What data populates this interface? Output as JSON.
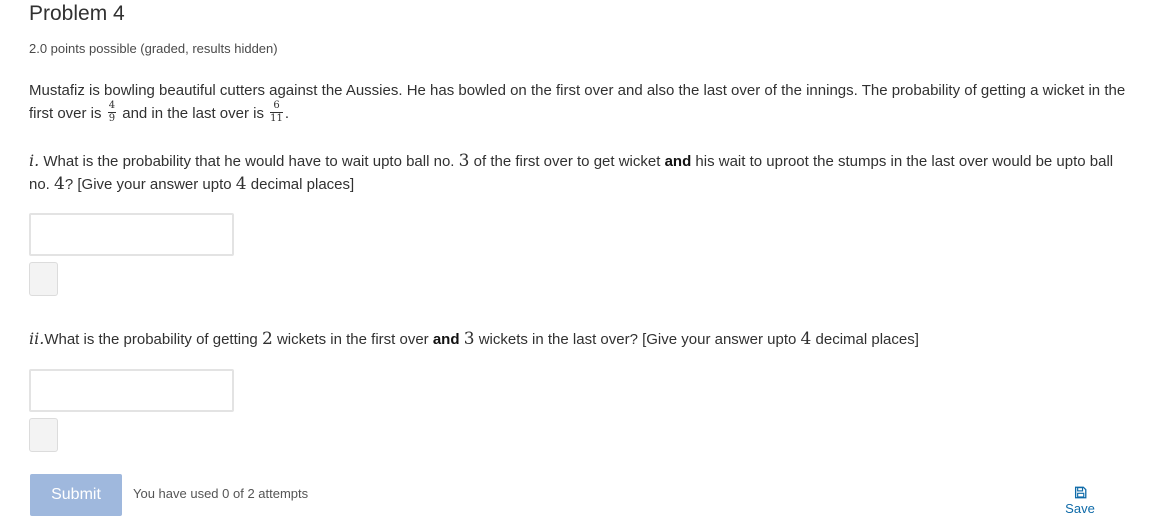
{
  "problem": {
    "title": "Problem 4",
    "points": "2.0 points possible (graded, results hidden)",
    "intro": {
      "text1": "Mustafiz is bowling beautiful cutters against the Aussies. He has bowled on the first over and also the last over of the innings. The probability of getting a wicket in the first over is",
      "frac1_num": "4",
      "frac1_den": "9",
      "text2": "and in the last over is",
      "frac2_num": "6",
      "frac2_den": "11",
      "text3": "."
    },
    "question1": {
      "label": "i.",
      "text1": "What is the probability that he would have to wait upto ball no.",
      "n1": "3",
      "text2": "of the first over to get wicket",
      "bold": "and",
      "text3": "his wait to uproot the stumps in the last over would be upto ball no.",
      "n2": "4",
      "text4": "? [Give your answer upto",
      "n3": "4",
      "text5": "decimal places]",
      "input_value": ""
    },
    "question2": {
      "label": "ii.",
      "text1": "What is the probability of getting",
      "n1": "2",
      "text2": "wickets in the first over",
      "bold": "and",
      "n2": "3",
      "text3": "wickets in the last over? [Give your answer upto",
      "n3": "4",
      "text4": "decimal places]",
      "input_value": ""
    }
  },
  "actions": {
    "submit_label": "Submit",
    "attempts_text": "You have used 0 of 2 attempts",
    "save_label": "Save",
    "save_icon": "save-icon"
  },
  "colors": {
    "submit_bg": "#9fb8dd",
    "link": "#0e6aa8",
    "text": "#313131"
  }
}
